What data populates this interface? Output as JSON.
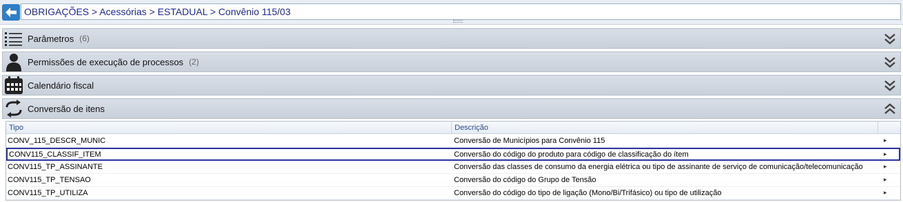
{
  "breadcrumb": {
    "path": "OBRIGAÇÕES > Acessórias > ESTADUAL > Convênio 115/03"
  },
  "sections": [
    {
      "title": "Parâmetros",
      "count": "(6)",
      "icon": "list-icon"
    },
    {
      "title": "Permissões de execução de processos",
      "count": "(2)",
      "icon": "user-icon"
    },
    {
      "title": "Calendário fiscal",
      "count": "",
      "icon": "calendar-icon"
    },
    {
      "title": "Conversão de itens",
      "count": "",
      "icon": "refresh-icon"
    }
  ],
  "grid": {
    "columns": [
      "Tipo",
      "Descrição"
    ],
    "rows": [
      {
        "tipo": "CONV_115_DESCR_MUNIC",
        "descricao": "Conversão de Municípios para Convênio 115"
      },
      {
        "tipo": "CONV115_CLASSIF_ITEM",
        "descricao": "Conversão do código do produto para código de classificação do ítem",
        "selected": true
      },
      {
        "tipo": "CONV115_TP_ASSINANTE",
        "descricao": "Conversão das classes de consumo da energia elétrica ou tipo de assinante de serviço de comunicação/telecomunicação"
      },
      {
        "tipo": "CONV115_TP_TENSAO",
        "descricao": "Conversão do código do Grupo de Tensão"
      },
      {
        "tipo": "CONV115_TP_UTILIZA",
        "descricao": "Conversão do código do tipo de ligação (Mono/Bi/Trifásico) ou tipo de utilização"
      }
    ]
  },
  "colors": {
    "accent": "#2f7fc8",
    "breadcrumb_text": "#1a2a9b",
    "selection_border": "#2a33a0"
  }
}
